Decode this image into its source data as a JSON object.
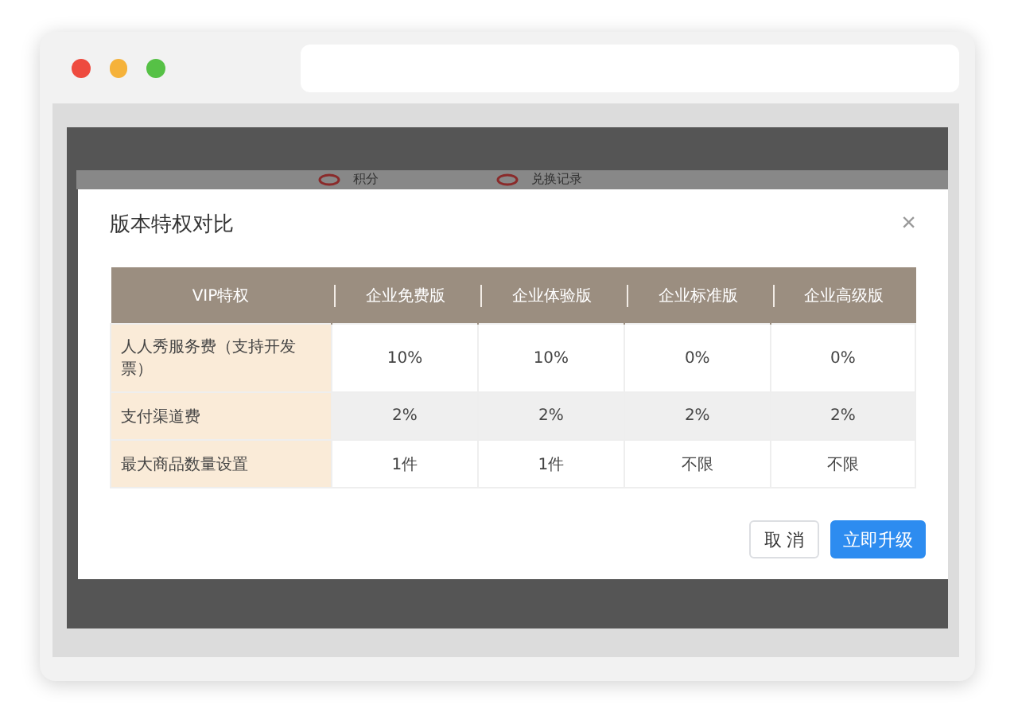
{
  "background_menu": [
    {
      "label": "积分"
    },
    {
      "label": "兑换记录"
    }
  ],
  "dialog": {
    "title": "版本特权对比",
    "close": "×",
    "table": {
      "columns": [
        "VIP特权",
        "企业免费版",
        "企业体验版",
        "企业标准版",
        "企业高级版"
      ],
      "rows": [
        {
          "cells": [
            "人人秀服务费（支持开发票）",
            "10%",
            "10%",
            "0%",
            "0%"
          ],
          "shaded": false
        },
        {
          "cells": [
            "支付渠道费",
            "2%",
            "2%",
            "2%",
            "2%"
          ],
          "shaded": true
        },
        {
          "cells": [
            "最大商品数量设置",
            "1件",
            "1件",
            "不限",
            "不限"
          ],
          "shaded": false
        }
      ]
    },
    "buttons": [
      {
        "label": "取 消",
        "kind": "secondary"
      },
      {
        "label": "立即升级",
        "kind": "primary"
      }
    ]
  }
}
